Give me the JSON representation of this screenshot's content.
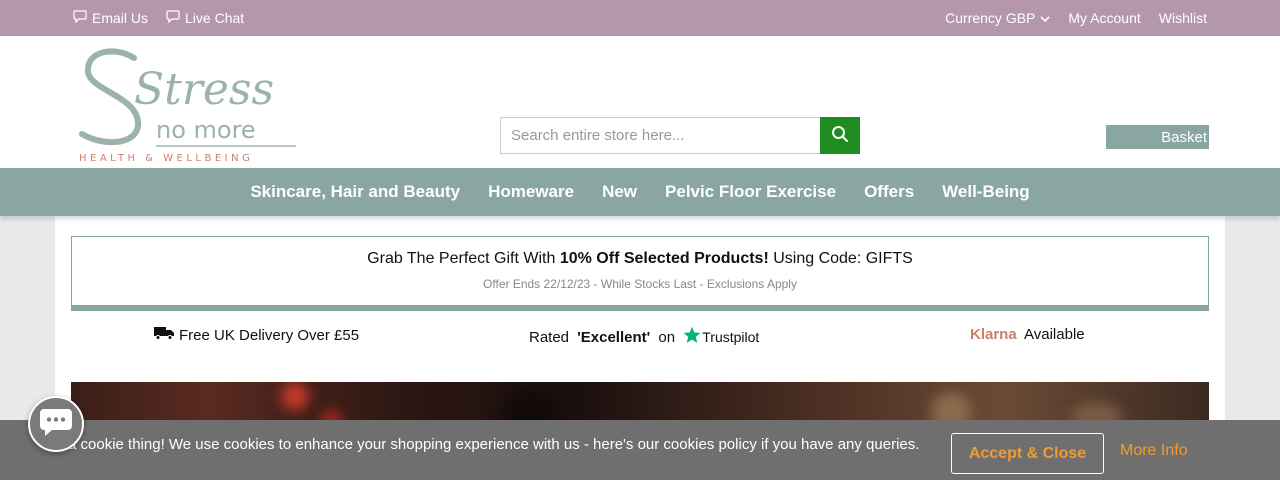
{
  "topbar": {
    "email_label": "Email Us",
    "chat_label": "Live Chat",
    "currency_label": "Currency GBP",
    "account_label": "My Account",
    "wishlist_label": "Wishlist"
  },
  "logo": {
    "line1": "Stress",
    "line2": "no more",
    "tagline": "HEALTH & WELLBEING"
  },
  "search": {
    "placeholder": "Search entire store here..."
  },
  "basket": {
    "label": "Basket"
  },
  "nav": {
    "items": [
      "Skincare, Hair and Beauty",
      "Homeware",
      "New",
      "Pelvic Floor Exercise",
      "Offers",
      "Well-Being"
    ]
  },
  "promo": {
    "prefix": "Grab The Perfect Gift With ",
    "highlight": "10% Off Selected Products!",
    "suffix": " Using Code: GIFTS",
    "subtext": "Offer Ends 22/12/23 - While Stocks Last - Exclusions Apply"
  },
  "usps": {
    "delivery": "Free UK Delivery Over £55",
    "rated_prefix": "Rated ",
    "rated_value": "'Excellent'",
    "rated_on": " on ",
    "trustpilot": "Trustpilot",
    "klarna": "Klarna",
    "klarna_suffix": " Available"
  },
  "cookie": {
    "text": "a cookie thing! We use cookies to enhance your shopping experience with us - here's our cookies policy if you have any queries.",
    "accept_label": "Accept & Close",
    "more_label": "More Info"
  },
  "colors": {
    "topbar": "#b597ad",
    "nav": "#8aa6a3",
    "search_button": "#1e8c1e",
    "cookie_bar": "#6f6f6f",
    "cookie_accent": "#f29b2f",
    "klarna": "#c8806a",
    "trustpilot_star": "#00b67a"
  }
}
